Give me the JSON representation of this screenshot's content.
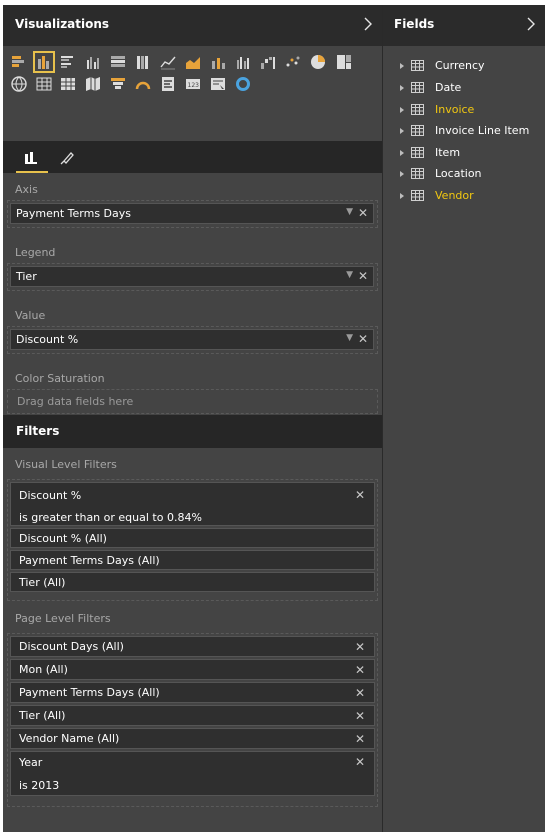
{
  "visualizations": {
    "title": "Visualizations",
    "collapse_icon": "chevron-right-icon",
    "gallery_rows": [
      [
        "stacked-bar-chart-icon",
        "stacked-column-chart-icon",
        "clustered-bar-chart-icon",
        "clustered-column-chart-icon",
        "100-stacked-bar-chart-icon",
        "100-stacked-column-chart-icon",
        "line-chart-icon",
        "area-chart-icon",
        "line-and-stacked-column-icon",
        "line-and-clustered-column-icon",
        "waterfall-chart-icon",
        "scatter-chart-icon",
        "pie-chart-icon",
        "treemap-icon"
      ],
      [
        "map-icon",
        "table-icon",
        "matrix-icon",
        "filled-map-icon",
        "funnel-icon",
        "gauge-icon",
        "multi-row-card-icon",
        "card-icon",
        "slicer-icon",
        "donut-chart-icon"
      ]
    ],
    "selected_visual": "stacked-column-chart-icon",
    "well_tabs": [
      "fields-tab-icon",
      "format-paintbrush-icon"
    ]
  },
  "wells": {
    "axis": {
      "label": "Axis",
      "field": "Payment Terms Days"
    },
    "legend": {
      "label": "Legend",
      "field": "Tier"
    },
    "value": {
      "label": "Value",
      "field": "Discount %"
    },
    "color_saturation": {
      "label": "Color Saturation",
      "placeholder": "Drag data fields here"
    }
  },
  "filters": {
    "title": "Filters",
    "visual_level": {
      "label": "Visual Level Filters",
      "expanded": {
        "name": "Discount %",
        "condition": "is greater than or equal to 0.84%"
      },
      "items": [
        "Discount % (All)",
        "Payment Terms Days (All)",
        "Tier (All)"
      ]
    },
    "page_level": {
      "label": "Page Level Filters",
      "items": [
        "Discount Days (All)",
        "Mon (All)",
        "Payment Terms Days (All)",
        "Tier (All)",
        "Vendor Name (All)"
      ],
      "expanded": {
        "name": "Year",
        "condition": "is 2013"
      }
    }
  },
  "fields": {
    "title": "Fields",
    "collapse_icon": "chevron-right-icon",
    "tables": [
      {
        "name": "Currency",
        "highlighted": false
      },
      {
        "name": "Date",
        "highlighted": false
      },
      {
        "name": "Invoice",
        "highlighted": true
      },
      {
        "name": "Invoice Line Item",
        "highlighted": false
      },
      {
        "name": "Item",
        "highlighted": false
      },
      {
        "name": "Location",
        "highlighted": false
      },
      {
        "name": "Vendor",
        "highlighted": true
      }
    ]
  },
  "colors": {
    "accent": "#e7c14c",
    "highlight_text": "#f2c811",
    "pane_bg": "#444444",
    "header_bg": "#2b2b2b"
  }
}
